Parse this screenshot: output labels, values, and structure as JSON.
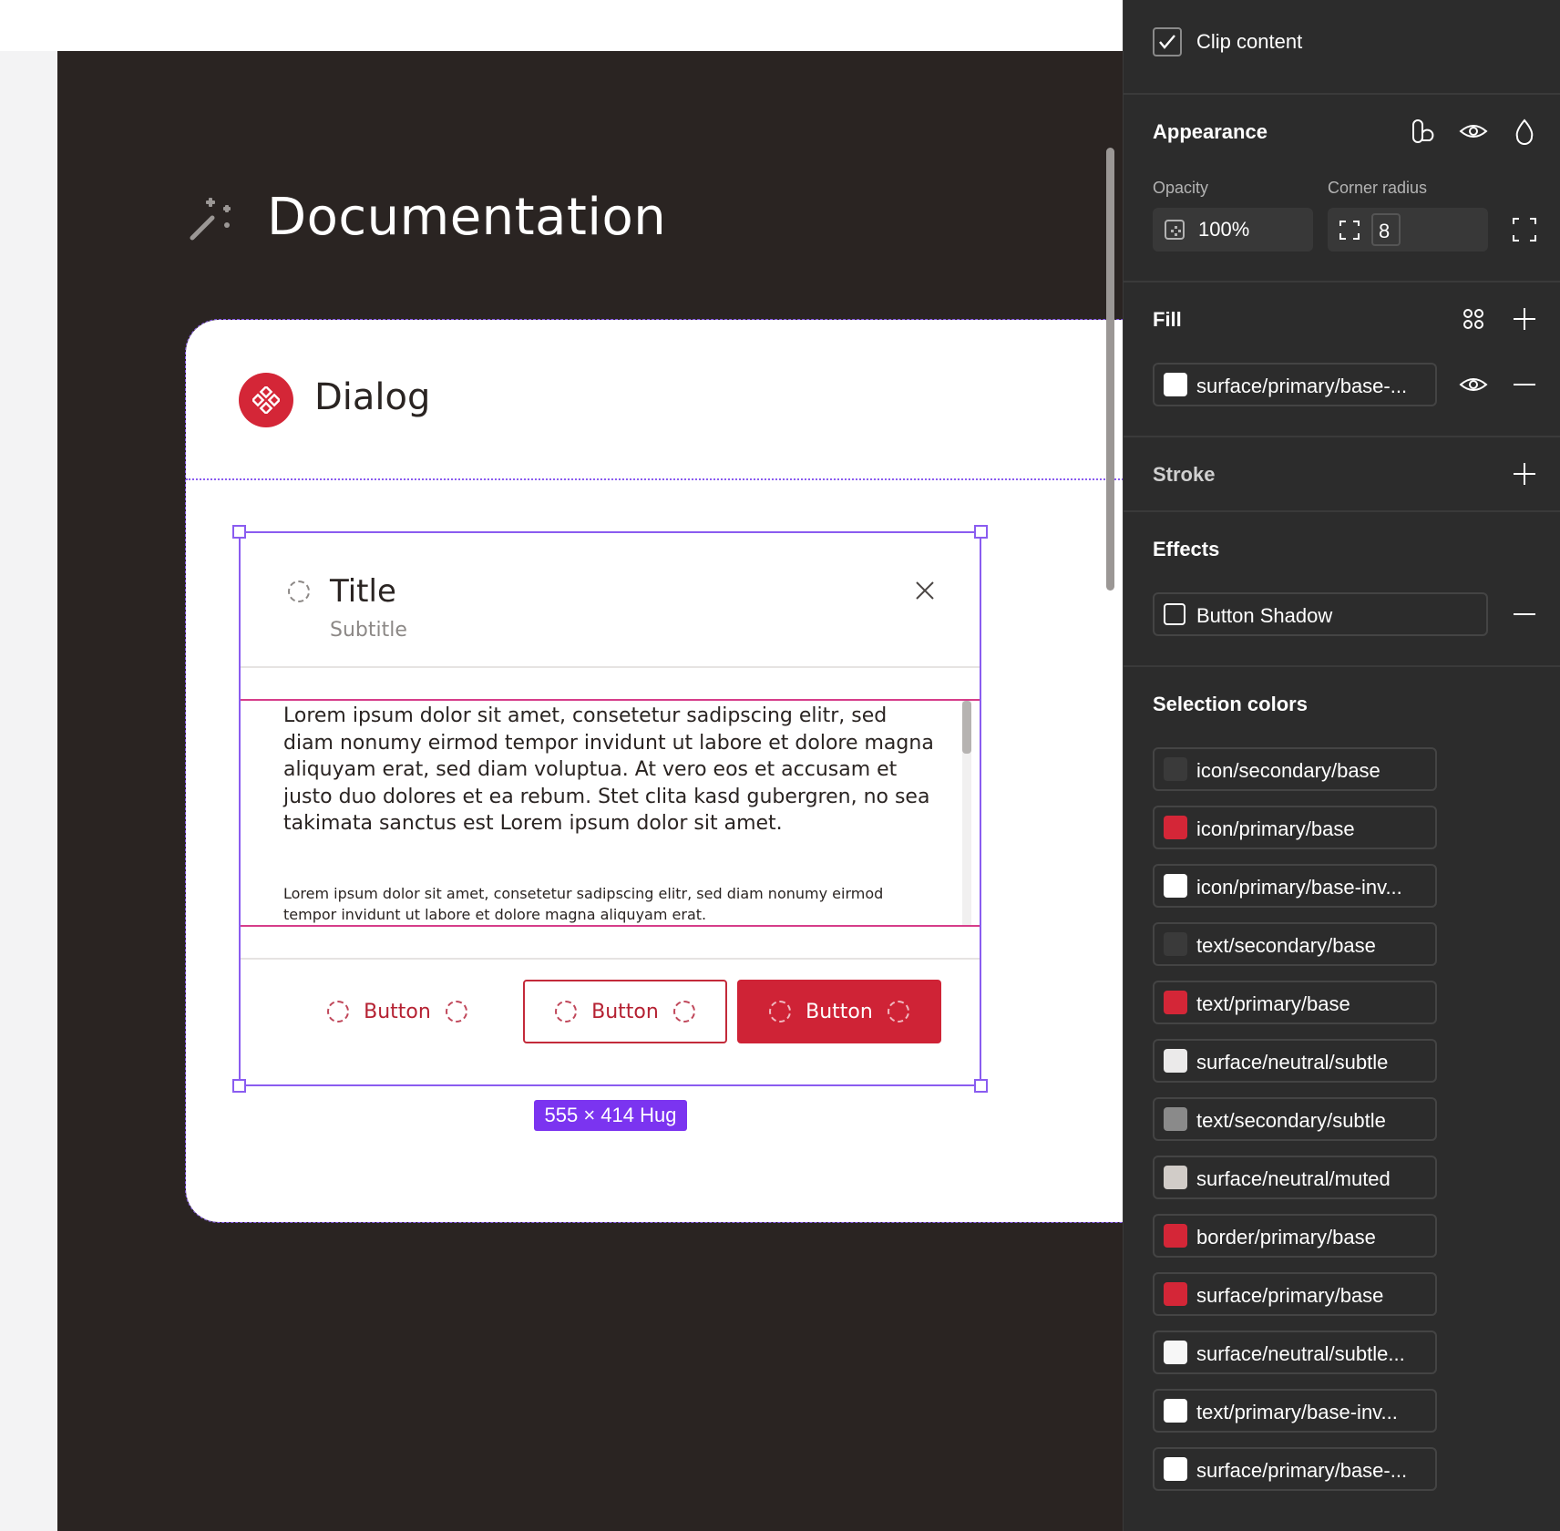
{
  "canvas": {
    "doc_title": "Documentation",
    "card_title": "Dialog"
  },
  "dialog": {
    "title": "Title",
    "subtitle": "Subtitle",
    "body_paragraph_1": "Lorem ipsum dolor sit amet, consetetur sadipscing elitr, sed diam nonumy eirmod tempor invidunt ut labore et dolore magna aliquyam erat, sed diam voluptua. At vero eos et accusam et justo duo dolores et ea rebum. Stet clita kasd gubergren, no sea takimata sanctus est Lorem ipsum dolor sit amet.",
    "body_paragraph_2": "Lorem ipsum dolor sit amet, consetetur sadipscing elitr, sed diam nonumy eirmod tempor invidunt ut labore et dolore magna aliquyam erat.",
    "buttons": [
      "Button",
      "Button",
      "Button"
    ],
    "size_badge": "555 × 414 Hug"
  },
  "panel": {
    "clip_content_label": "Clip content",
    "clip_content_checked": true,
    "appearance": {
      "heading": "Appearance",
      "opacity_label": "Opacity",
      "opacity_value": "100%",
      "corner_radius_label": "Corner radius",
      "corner_radius_value": "8"
    },
    "fill": {
      "heading": "Fill",
      "item": {
        "name": "surface/primary/base-...",
        "color": "#ffffff"
      }
    },
    "stroke": {
      "heading": "Stroke"
    },
    "effects": {
      "heading": "Effects",
      "item": "Button Shadow"
    },
    "selection_colors": {
      "heading": "Selection colors",
      "items": [
        {
          "name": "icon/secondary/base",
          "color": "#3a3a3a"
        },
        {
          "name": "icon/primary/base",
          "color": "#d42637"
        },
        {
          "name": "icon/primary/base-inv...",
          "color": "#ffffff"
        },
        {
          "name": "text/secondary/base",
          "color": "#3a3a3a"
        },
        {
          "name": "text/primary/base",
          "color": "#d42637"
        },
        {
          "name": "surface/neutral/subtle",
          "color": "#ebeaea"
        },
        {
          "name": "text/secondary/subtle",
          "color": "#8a8a8a"
        },
        {
          "name": "surface/neutral/muted",
          "color": "#d1ccc8"
        },
        {
          "name": "border/primary/base",
          "color": "#d42637"
        },
        {
          "name": "surface/primary/base",
          "color": "#d42637"
        },
        {
          "name": "surface/neutral/subtle...",
          "color": "#f7f7f7"
        },
        {
          "name": "text/primary/base-inv...",
          "color": "#ffffff"
        },
        {
          "name": "surface/primary/base-...",
          "color": "#ffffff"
        }
      ]
    }
  },
  "colors": {
    "accent_selection": "#8a5cf0",
    "brand_red": "#d42637",
    "canvas_bg": "#2a2422",
    "panel_bg": "#2c2c2c"
  }
}
